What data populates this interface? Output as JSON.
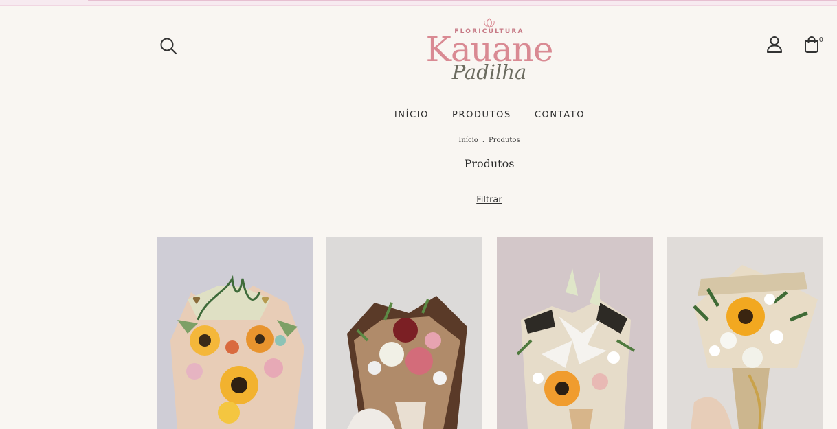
{
  "header": {
    "logo": {
      "line1": "FLORICULTURA",
      "line2": "Kauane",
      "line3": "Padilha"
    },
    "cart_count": "0",
    "icons": {
      "search": "search-icon",
      "account": "user-icon",
      "cart": "shopping-bag-icon"
    }
  },
  "nav": {
    "items": [
      {
        "label": "INÍCIO"
      },
      {
        "label": "PRODUTOS"
      },
      {
        "label": "CONTATO"
      }
    ]
  },
  "breadcrumb": {
    "home": "Início",
    "separator": ".",
    "current": "Produtos"
  },
  "page": {
    "title": "Produtos",
    "filter_label": "Filtrar"
  },
  "products": [
    {
      "image": "bouquet-sunflowers-pink-wrap"
    },
    {
      "image": "bouquet-roses-alstroemeria-bronze-wrap"
    },
    {
      "image": "bouquet-lily-sunflower-newspaper-wrap"
    },
    {
      "image": "bouquet-sunflower-white-roses-newspaper-wrap"
    }
  ],
  "colors": {
    "background": "#f9f6f2",
    "top_bar": "#f7eaf0",
    "logo_pink": "#d98a93",
    "logo_gray": "#6b6b5f"
  }
}
